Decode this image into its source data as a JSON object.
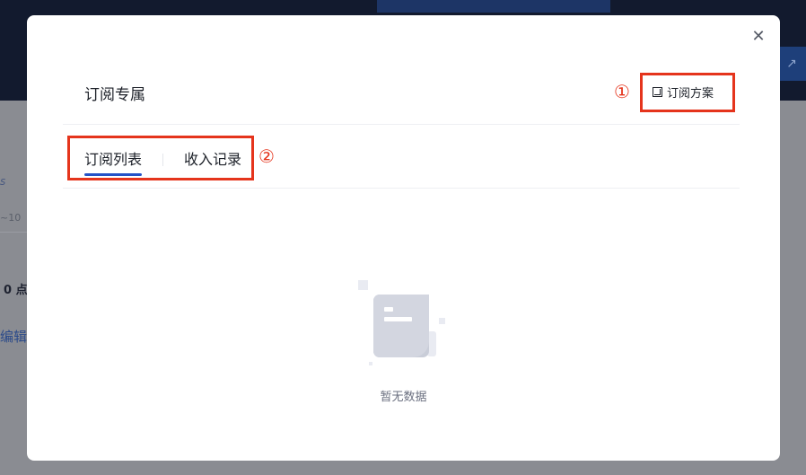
{
  "background": {
    "fragments": [
      "s",
      "~10",
      "0 点",
      "编辑"
    ],
    "side_button_icon": "external-link-icon"
  },
  "modal": {
    "title": "订阅专属",
    "plan_button": {
      "label": "订阅方案",
      "icon": "plan-icon"
    },
    "close_icon": "close-icon",
    "tabs": [
      {
        "label": "订阅列表",
        "active": true
      },
      {
        "label": "收入记录",
        "active": false
      }
    ],
    "empty_state": {
      "text": "暂无数据",
      "icon": "empty-document-icon"
    }
  },
  "annotations": {
    "marker_1": "①",
    "marker_2": "②",
    "color": "#e5341c"
  },
  "colors": {
    "accent": "#2452c7",
    "text": "#1d2129",
    "muted": "#6b7080"
  }
}
